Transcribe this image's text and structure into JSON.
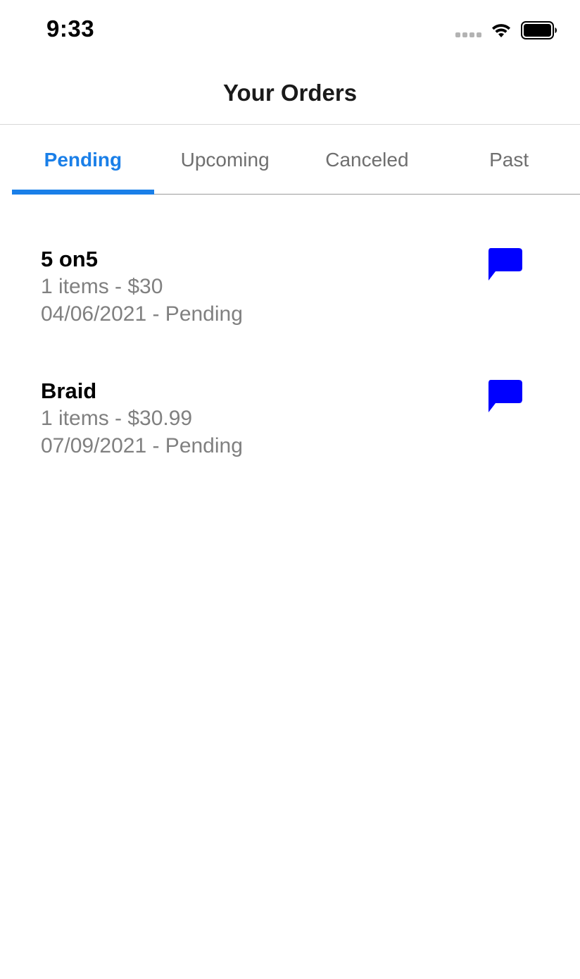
{
  "status_bar": {
    "time": "9:33",
    "icons": [
      "signal-dots-icon",
      "wifi-icon",
      "battery-icon"
    ]
  },
  "header": {
    "title": "Your Orders"
  },
  "tabs": [
    {
      "label": "Pending",
      "active": true
    },
    {
      "label": "Upcoming",
      "active": false
    },
    {
      "label": "Canceled",
      "active": false
    },
    {
      "label": "Past",
      "active": false
    }
  ],
  "orders": [
    {
      "name": "5 on5",
      "summary": "1 items - $30",
      "date_status": "04/06/2021 - Pending",
      "icon": "chat-bubble-icon"
    },
    {
      "name": "Braid",
      "summary": "1 items - $30.99",
      "date_status": "07/09/2021 - Pending",
      "icon": "chat-bubble-icon"
    }
  ],
  "colors": {
    "accent": "#1a7fe8",
    "chat_icon": "#0000ff",
    "secondary_text": "#808080",
    "inactive_tab": "#6f6f6f"
  }
}
